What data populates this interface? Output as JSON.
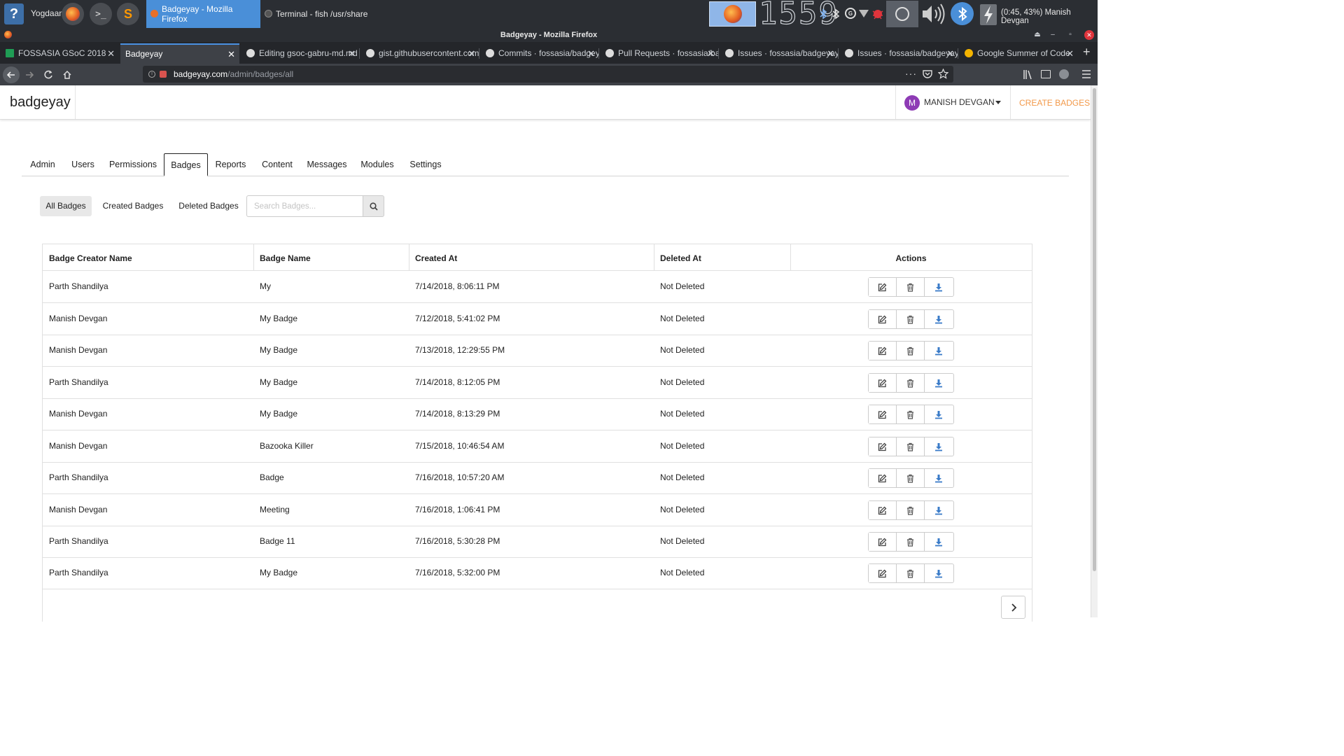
{
  "taskbar": {
    "user_label": "Yogdaan",
    "tasks": [
      {
        "label": "Badgeyay - Mozilla Firefox",
        "active": true
      },
      {
        "label": "Terminal - fish  /usr/share",
        "active": false
      }
    ],
    "clock_digits": "1559",
    "status": "(0:45, 43%)  Manish Devgan"
  },
  "browser": {
    "window_title": "Badgeyay - Mozilla Firefox",
    "tabs": [
      {
        "label": "FOSSASIA GSoC 2018",
        "icon": "sheets-icon"
      },
      {
        "label": "Badgeyay",
        "icon": "none",
        "active": true
      },
      {
        "label": "Editing gsoc-gabru-md.md",
        "icon": "github-icon"
      },
      {
        "label": "gist.githubusercontent.com",
        "icon": "github-icon"
      },
      {
        "label": "Commits · fossasia/badgeyay",
        "icon": "github-icon"
      },
      {
        "label": "Pull Requests · fossasia/badgeyay",
        "icon": "github-icon"
      },
      {
        "label": "Issues · fossasia/badgeyay",
        "icon": "github-icon"
      },
      {
        "label": "Issues · fossasia/badgeyay",
        "icon": "github-icon"
      },
      {
        "label": "Google Summer of Code",
        "icon": "gsoc-icon"
      }
    ],
    "url_host": "badgeyay.com",
    "url_path": "/admin/badges/all"
  },
  "app": {
    "brand": "badgeyay",
    "user": {
      "initial": "M",
      "name": "MANISH DEVGAN"
    },
    "create_link": "CREATE BADGES",
    "admin_tabs": [
      "Admin",
      "Users",
      "Permissions",
      "Badges",
      "Reports",
      "Content",
      "Messages",
      "Modules",
      "Settings"
    ],
    "active_admin_tab": "Badges",
    "sub_tabs": [
      "All Badges",
      "Created Badges",
      "Deleted Badges"
    ],
    "active_sub_tab": "All Badges",
    "search": {
      "placeholder": "Search Badges...",
      "value": ""
    }
  },
  "table": {
    "headers": [
      "Badge Creator Name",
      "Badge Name",
      "Created At",
      "Deleted At",
      "Actions"
    ],
    "rows": [
      {
        "creator": "Parth Shandilya",
        "name": "My",
        "created": "7/14/2018, 8:06:11 PM",
        "deleted": "Not Deleted"
      },
      {
        "creator": "Manish Devgan",
        "name": "My Badge",
        "created": "7/12/2018, 5:41:02 PM",
        "deleted": "Not Deleted"
      },
      {
        "creator": "Manish Devgan",
        "name": "My Badge",
        "created": "7/13/2018, 12:29:55 PM",
        "deleted": "Not Deleted"
      },
      {
        "creator": "Parth Shandilya",
        "name": "My Badge",
        "created": "7/14/2018, 8:12:05 PM",
        "deleted": "Not Deleted"
      },
      {
        "creator": "Manish Devgan",
        "name": "My Badge",
        "created": "7/14/2018, 8:13:29 PM",
        "deleted": "Not Deleted"
      },
      {
        "creator": "Manish Devgan",
        "name": "Bazooka Killer",
        "created": "7/15/2018, 10:46:54 AM",
        "deleted": "Not Deleted"
      },
      {
        "creator": "Parth Shandilya",
        "name": "Badge",
        "created": "7/16/2018, 10:57:20 AM",
        "deleted": "Not Deleted"
      },
      {
        "creator": "Manish Devgan",
        "name": "Meeting",
        "created": "7/16/2018, 1:06:41 PM",
        "deleted": "Not Deleted"
      },
      {
        "creator": "Parth Shandilya",
        "name": "Badge 11",
        "created": "7/16/2018, 5:30:28 PM",
        "deleted": "Not Deleted"
      },
      {
        "creator": "Parth Shandilya",
        "name": "My Badge",
        "created": "7/16/2018, 5:32:00 PM",
        "deleted": "Not Deleted"
      }
    ],
    "row_actions": [
      "edit-icon",
      "trash-icon",
      "download-icon"
    ]
  },
  "colors": {
    "accent_orange": "#f2994a",
    "active_task_blue": "#4a8fd8",
    "download_blue": "#3a7bc8",
    "avatar_purple": "#8e3bb5"
  }
}
